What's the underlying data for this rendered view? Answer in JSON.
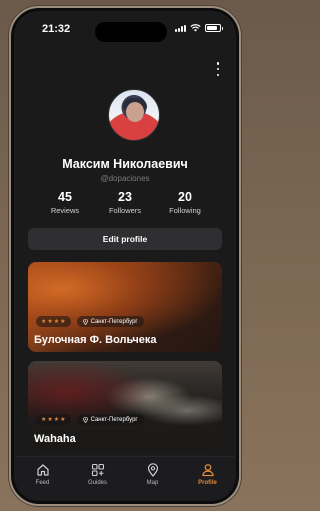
{
  "status_bar": {
    "time": "21:32",
    "battery_level": 0.8
  },
  "profile": {
    "name": "Максим Николаевич",
    "handle": "@dopaciones",
    "stats": [
      {
        "value": "45",
        "label": "Reviews"
      },
      {
        "value": "23",
        "label": "Followers"
      },
      {
        "value": "20",
        "label": "Following"
      }
    ],
    "edit_label": "Edit profile"
  },
  "cards": [
    {
      "title": "Булочная Ф. Вольчека",
      "rating": 4,
      "location": "Санкт-Петербург"
    },
    {
      "title": "Wahaha",
      "rating": 4,
      "location": "Санкт-Петербург"
    }
  ],
  "tabs": [
    {
      "label": "Feed",
      "icon": "home-icon",
      "active": false
    },
    {
      "label": "Guides",
      "icon": "grid-plus-icon",
      "active": false
    },
    {
      "label": "Map",
      "icon": "map-pin-icon",
      "active": false
    },
    {
      "label": "Profile",
      "icon": "person-icon",
      "active": true
    }
  ],
  "colors": {
    "accent": "#e08a3c",
    "background": "#1a1a1b",
    "button": "#2f2f31"
  }
}
